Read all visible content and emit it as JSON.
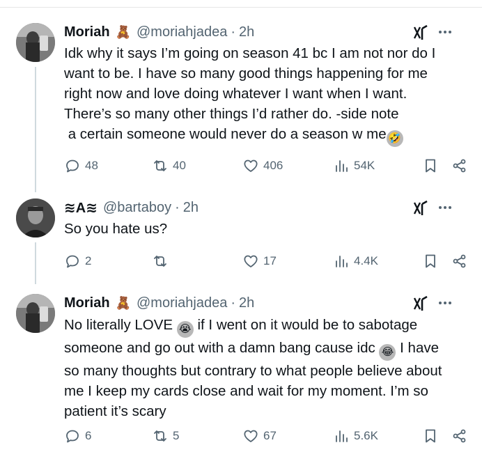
{
  "tweets": [
    {
      "name": "Moriah",
      "badge": "🧸",
      "handle": "@moriahjadea",
      "time": "2h",
      "text_lines": [
        "Idk why it says I’m going on season 41 bc I am not nor do I",
        "want to be. I have so many good things happening for me",
        "right now and love doing whatever I want when I want.",
        "There’s so many other things I’d rather do. -side note",
        " a certain someone would never do a season w me"
      ],
      "emoji_end": "🤣",
      "replies": "48",
      "reposts": "40",
      "likes": "406",
      "views": "54K"
    },
    {
      "name": "≋A≋",
      "handle": "@bartaboy",
      "time": "2h",
      "text_lines": [
        "So you hate us?"
      ],
      "replies": "2",
      "reposts": "",
      "likes": "17",
      "views": "4.4K"
    },
    {
      "name": "Moriah",
      "badge": "🧸",
      "handle": "@moriahjadea",
      "time": "2h",
      "line1_a": "No literally LOVE ",
      "emoji_a": "😭",
      "line1_b": " if I went on it would be to sabotage",
      "line2_a": "someone and go out with a damn bang cause idc ",
      "emoji_b": "😂",
      "line2_b": " I have",
      "line3": "so many thoughts but contrary to what people believe about",
      "line4": "me I keep my cards close and wait for my moment. I’m so",
      "line5": "patient it’s scary",
      "replies": "6",
      "reposts": "5",
      "likes": "67",
      "views": "5.6K"
    }
  ],
  "icons": {
    "reply": "reply-icon",
    "repost": "repost-icon",
    "like": "like-icon",
    "views": "views-icon",
    "bookmark": "bookmark-icon",
    "share": "share-icon",
    "grok": "grok-icon",
    "more": "more-icon"
  },
  "colors": {
    "text": "#0f1419",
    "secondary": "#536471",
    "thread_line": "#cfd9de"
  }
}
